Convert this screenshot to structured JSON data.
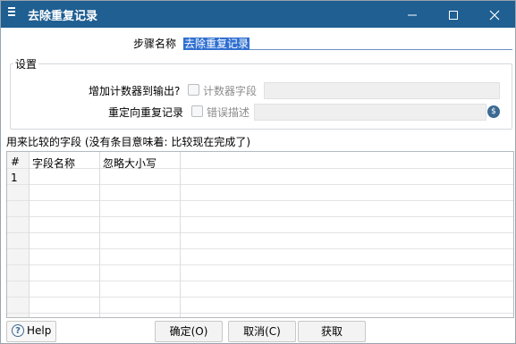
{
  "window": {
    "title": "去除重复记录"
  },
  "step": {
    "label": "步骤名称",
    "value": "去除重复记录"
  },
  "settings": {
    "group_label": "设置",
    "add_counter_label": "增加计数器到输出?",
    "counter_field_label": "计数器字段",
    "redirect_label": "重定向重复记录",
    "error_desc_label": "错误描述"
  },
  "compare": {
    "label": "用来比较的字段 (没有条目意味着: 比较现在完成了)"
  },
  "table": {
    "headers": [
      "#",
      "字段名称",
      "忽略大小写"
    ],
    "rows": [
      {
        "num": "1",
        "field": "",
        "ignore_case": ""
      }
    ]
  },
  "buttons": {
    "help": "Help",
    "ok": "确定(O)",
    "cancel": "取消(C)",
    "get": "获取"
  },
  "colors": {
    "titlebar": "#1f5f92",
    "selection": "#2f6fd1"
  }
}
